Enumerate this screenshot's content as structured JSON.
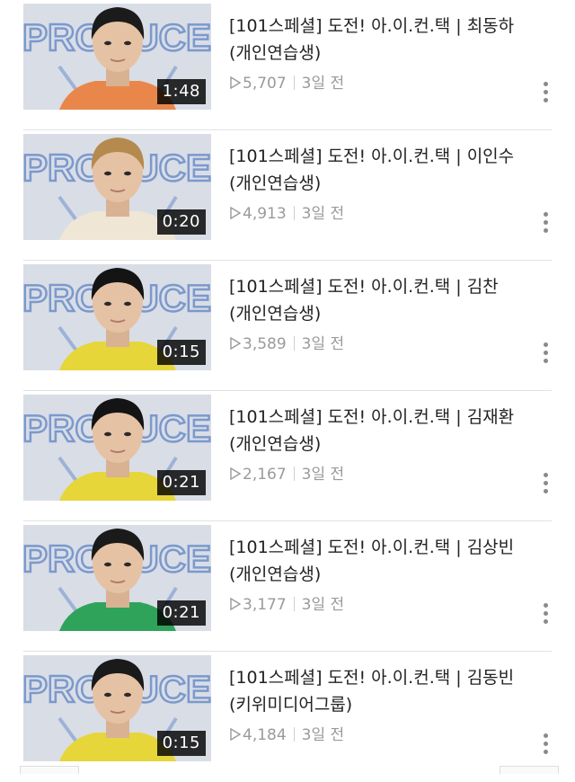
{
  "colors": {
    "title_text": "#222222",
    "meta_text": "#9a9a9a",
    "duration_bg": "#000000",
    "divider": "#e2e2e2",
    "thumb_backdrop": "#d9dde6",
    "produce_logo_blue": "#2f62b8"
  },
  "videos": [
    {
      "title": "[101스페셜] 도전! 아.이.컨.택 | 최동하 (개인연습생)",
      "duration": "1:48",
      "views": "5,707",
      "age": "3일 전",
      "shirt_color": "#e9874a",
      "hair_color": "#1b1b1b",
      "logo_text": "PRODUCE"
    },
    {
      "title": "[101스페셜] 도전! 아.이.컨.택 | 이인수 (개인연습생)",
      "duration": "0:20",
      "views": "4,913",
      "age": "3일 전",
      "shirt_color": "#efe6d6",
      "hair_color": "#b58a4e",
      "logo_text": "PRODUCE"
    },
    {
      "title": "[101스페셜] 도전! 아.이.컨.택 | 김찬 (개인연습생)",
      "duration": "0:15",
      "views": "3,589",
      "age": "3일 전",
      "shirt_color": "#e6d63a",
      "hair_color": "#141414",
      "logo_text": "PRODUCE"
    },
    {
      "title": "[101스페셜] 도전! 아.이.컨.택 | 김재환 (개인연습생)",
      "duration": "0:21",
      "views": "2,167",
      "age": "3일 전",
      "shirt_color": "#e6d63a",
      "hair_color": "#141414",
      "logo_text": "PRODUCE"
    },
    {
      "title": "[101스페셜] 도전! 아.이.컨.택 | 김상빈 (개인연습생)",
      "duration": "0:21",
      "views": "3,177",
      "age": "3일 전",
      "shirt_color": "#2fa35a",
      "hair_color": "#1a1a1a",
      "logo_text": "PRODUCE"
    },
    {
      "title": "[101스페셜] 도전! 아.이.컨.택 | 김동빈 (키위미디어그룹)",
      "duration": "0:15",
      "views": "4,184",
      "age": "3일 전",
      "shirt_color": "#e6d63a",
      "hair_color": "#1a1a1a",
      "logo_text": "PRODUCE"
    }
  ]
}
